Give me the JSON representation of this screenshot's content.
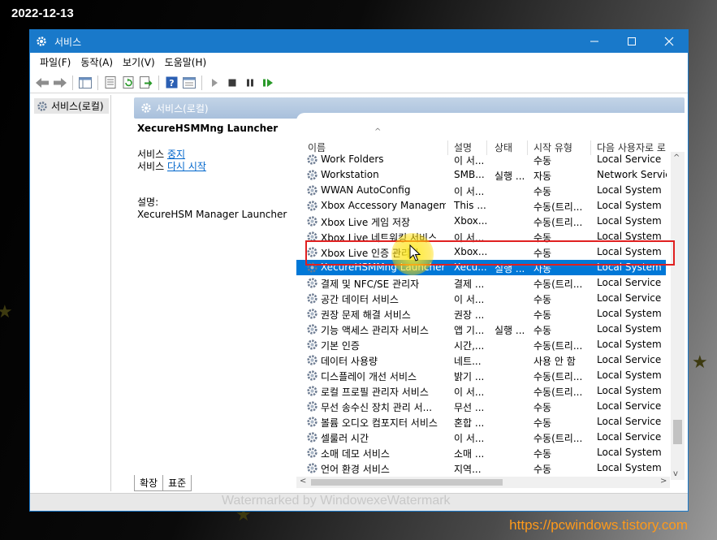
{
  "overlay": {
    "date": "2022-12-13",
    "site_url": "https://pcwindows.tistory.com",
    "watermark": "Watermarked by WindowexeWatermark"
  },
  "window": {
    "title": "서비스",
    "controls": [
      "minimize-icon",
      "maximize-icon",
      "close-icon"
    ]
  },
  "menu": [
    "파일(F)",
    "동작(A)",
    "보기(V)",
    "도움말(H)"
  ],
  "toolbar_icons": [
    "back-arrow-icon",
    "forward-arrow-icon",
    "show-tree-icon",
    "properties-icon",
    "refresh-icon",
    "export-icon",
    "help-icon",
    "console-icon",
    "start-icon",
    "stop-icon",
    "pause-icon",
    "restart-icon"
  ],
  "tree": {
    "root": "서비스(로컬)"
  },
  "pane": {
    "header": "서비스(로컬)",
    "selected_service": "XecureHSMMng Launcher",
    "action_prefix_1": "서비스 ",
    "action_link_1": "중지",
    "action_prefix_2": "서비스 ",
    "action_link_2": "다시 시작",
    "desc_label": "설명:",
    "desc_text": "XecureHSM Manager Launcher"
  },
  "columns": {
    "name": "이름",
    "desc": "설명",
    "status": "상태",
    "startup": "시작 유형",
    "logon": "다음 사용자로 로"
  },
  "services": [
    {
      "name": "Work Folders",
      "desc": "이 서...",
      "status": "",
      "startup": "수동",
      "logon": "Local Service"
    },
    {
      "name": "Workstation",
      "desc": "SMB...",
      "status": "실행 ...",
      "startup": "자동",
      "logon": "Network Service"
    },
    {
      "name": "WWAN AutoConfig",
      "desc": "이 서...",
      "status": "",
      "startup": "수동",
      "logon": "Local System"
    },
    {
      "name": "Xbox Accessory Managem...",
      "desc": "This ...",
      "status": "",
      "startup": "수동(트리...",
      "logon": "Local System"
    },
    {
      "name": "Xbox Live 게임 저장",
      "desc": "Xbox...",
      "status": "",
      "startup": "수동(트리...",
      "logon": "Local System"
    },
    {
      "name": "Xbox Live 네트워킹 서비스",
      "desc": "이 서...",
      "status": "",
      "startup": "수동",
      "logon": "Local System"
    },
    {
      "name": "Xbox Live 인증 관리자",
      "desc": "Xbox...",
      "status": "",
      "startup": "수동",
      "logon": "Local System"
    },
    {
      "name": "XecureHSMMng Launcher",
      "desc": "Xecu...",
      "status": "실행 ...",
      "startup": "자동",
      "logon": "Local System",
      "selected": true
    },
    {
      "name": "결제 및 NFC/SE 관리자",
      "desc": "결제 ...",
      "status": "",
      "startup": "수동(트리...",
      "logon": "Local Service"
    },
    {
      "name": "공간 데이터 서비스",
      "desc": "이 서...",
      "status": "",
      "startup": "수동",
      "logon": "Local Service"
    },
    {
      "name": "권장 문제 해결 서비스",
      "desc": "권장 ...",
      "status": "",
      "startup": "수동",
      "logon": "Local System"
    },
    {
      "name": "기능 액세스 관리자 서비스",
      "desc": "앱 기...",
      "status": "실행 ...",
      "startup": "수동",
      "logon": "Local System"
    },
    {
      "name": "기본 인증",
      "desc": "시간,...",
      "status": "",
      "startup": "수동(트리...",
      "logon": "Local System"
    },
    {
      "name": "데이터 사용량",
      "desc": "네트...",
      "status": "",
      "startup": "사용 안 함",
      "logon": "Local Service"
    },
    {
      "name": "디스플레이 개선 서비스",
      "desc": "밝기 ...",
      "status": "",
      "startup": "수동(트리...",
      "logon": "Local System"
    },
    {
      "name": "로컬 프로필 관리자 서비스",
      "desc": "이 서...",
      "status": "",
      "startup": "수동(트리...",
      "logon": "Local System"
    },
    {
      "name": "무선 송수신 장치 관리 서...",
      "desc": "무선 ...",
      "status": "",
      "startup": "수동",
      "logon": "Local Service"
    },
    {
      "name": "볼륨 오디오 컴포지터 서비스",
      "desc": "혼합 ...",
      "status": "",
      "startup": "수동",
      "logon": "Local Service"
    },
    {
      "name": "셀룰러 시간",
      "desc": "이 서...",
      "status": "",
      "startup": "수동(트리...",
      "logon": "Local Service"
    },
    {
      "name": "소매 데모 서비스",
      "desc": "소매 ...",
      "status": "",
      "startup": "수동",
      "logon": "Local System"
    },
    {
      "name": "언어 환경 서비스",
      "desc": "지역...",
      "status": "",
      "startup": "수동",
      "logon": "Local System"
    }
  ],
  "tabs": [
    "확장",
    "표준"
  ],
  "colors": {
    "accent": "#1979ca",
    "selection": "#0078d7",
    "highlight_box": "#e02020",
    "link": "#0066cc"
  }
}
